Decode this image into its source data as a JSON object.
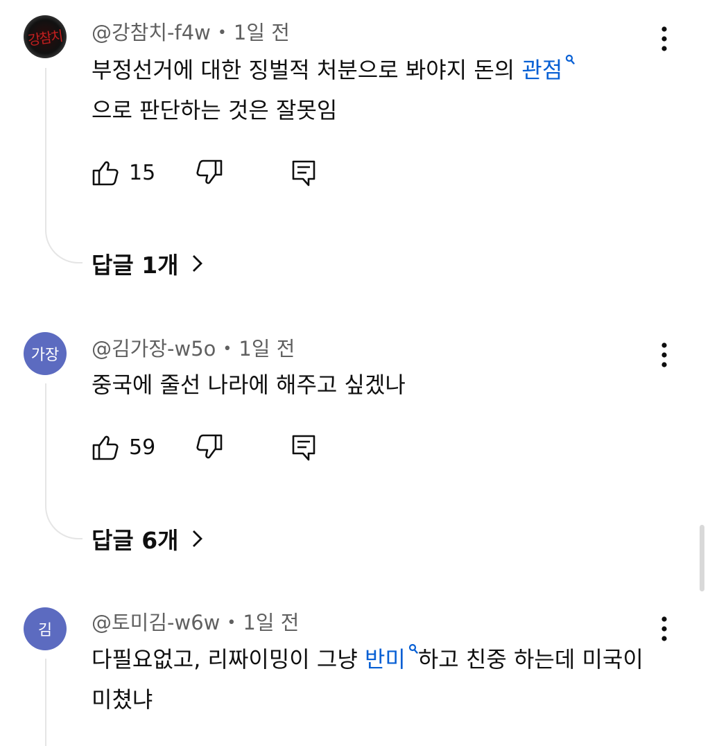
{
  "comments": [
    {
      "avatar_text": "강참치",
      "author": "@강참치-f4w",
      "time": "1일 전",
      "text_before": "부정선거에 대한 징벌적 처분으로  봐야지 돈의 ",
      "link": "관점",
      "text_after": "으로 판단하는 것은 잘못임",
      "likes": "15",
      "replies": "답글 1개"
    },
    {
      "avatar_text": "가장",
      "author": "@김가장-w5o",
      "time": "1일 전",
      "text": "중국에 줄선 나라에 해주고 싶겠나",
      "likes": "59",
      "replies": "답글 6개"
    },
    {
      "avatar_text": "김",
      "author": "@토미김-w6w",
      "time": "1일 전",
      "text_before": "다필요없고, 리짜이밍이 그냥 ",
      "link": "반미",
      "text_after": "하고 친중 하는데 미국이 미쳤냐"
    }
  ],
  "icons": {
    "like": "thumbs-up-icon",
    "dislike": "thumbs-down-icon",
    "reply": "reply-comment-icon",
    "more": "more-vertical-icon",
    "chevron": "chevron-right-icon",
    "search": "search-icon"
  },
  "colors": {
    "link": "#065fd4",
    "avatar_purple": "#5c6bc0",
    "meta": "#606060"
  }
}
